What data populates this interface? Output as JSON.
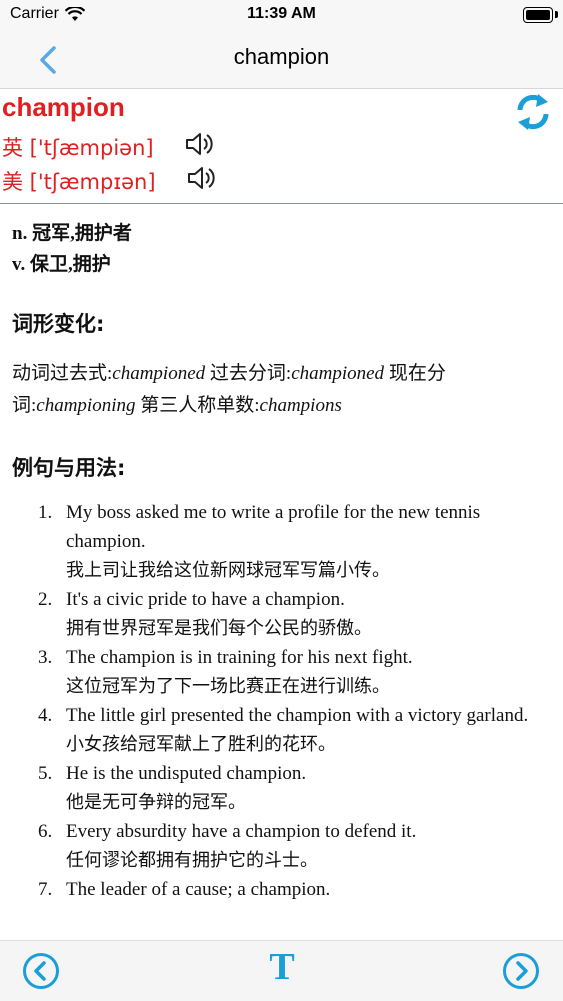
{
  "status": {
    "carrier": "Carrier",
    "time": "11:39 AM"
  },
  "nav": {
    "title": "champion"
  },
  "word": {
    "headword": "champion",
    "uk_pron": "英 ['tʃæmpiən]",
    "us_pron": "美 ['tʃæmpɪən]"
  },
  "definitions": [
    "n. 冠军,拥护者",
    "v. 保卫,拥护"
  ],
  "forms_section": {
    "title": "词形变化:",
    "past_label": "动词过去式:",
    "past_value": "championed",
    "pp_label": " 过去分词:",
    "pp_value": "championed",
    "prog_label": " 现在分词:",
    "prog_value": "championing",
    "third_label": " 第三人称单数:",
    "third_value": "champions"
  },
  "examples_section": {
    "title": "例句与用法:",
    "items": [
      {
        "num": "1.",
        "en": "My boss asked me to write a profile for the new tennis champion.",
        "cn": "我上司让我给这位新网球冠军写篇小传。"
      },
      {
        "num": "2.",
        "en": "It's a civic pride to have a champion.",
        "cn": "拥有世界冠军是我们每个公民的骄傲。"
      },
      {
        "num": "3.",
        "en": "The champion is in training for his next fight.",
        "cn": "这位冠军为了下一场比赛正在进行训练。"
      },
      {
        "num": "4.",
        "en": "The little girl presented the champion with a victory garland.",
        "cn": "小女孩给冠军献上了胜利的花环。"
      },
      {
        "num": "5.",
        "en": "He is the undisputed champion.",
        "cn": "他是无可争辩的冠军。"
      },
      {
        "num": "6.",
        "en": "Every absurdity have a champion to defend it.",
        "cn": "任何谬论都拥有拥护它的斗士。"
      },
      {
        "num": "7.",
        "en": "The leader of a cause; a champion.",
        "cn": ""
      }
    ]
  },
  "toolbar": {
    "font_label": "T"
  },
  "colors": {
    "accent": "#1a9fd8",
    "headword": "#e02020",
    "nav_back": "#5aa9e6"
  },
  "icons": [
    "back-chevron-icon",
    "refresh-icon",
    "speaker-icon",
    "prev-circle-icon",
    "font-icon",
    "next-circle-icon"
  ]
}
